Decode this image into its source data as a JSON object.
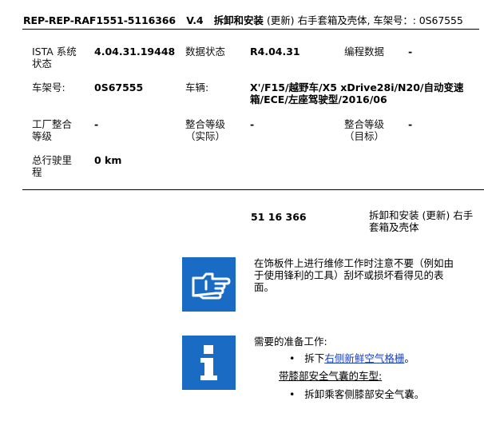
{
  "header": {
    "doc_code": "REP-REP-RAF1551-5116366",
    "version": "V.4",
    "title_cn": "拆卸和安装",
    "update_tag": "(更新)",
    "title_rest": "右手套箱及壳体, 车架号：: 0S67555"
  },
  "info": {
    "ista_label": "ISTA 系统\n状态",
    "ista_value": "4.04.31.19448",
    "data_status_label": "数据状态",
    "data_status_value": "R4.04.31",
    "program_data_label": "编程数据",
    "program_data_value": "-",
    "vin_label": "车架号:",
    "vin_value": "0S67555",
    "vehicle_label": "车辆:",
    "vehicle_value": "X'/F15/越野车/X5 xDrive28i/N20/自动变速\n箱/ECE/左座驾驶型/2016/06",
    "factory_level_label": "工厂整合\n等级",
    "factory_level_value": "-",
    "actual_level_label": "整合等级\n（实际）",
    "actual_level_value": "-",
    "target_level_label": "整合等级\n（目标）",
    "target_level_value": "-",
    "mileage_label": "总行驶里\n程",
    "mileage_value": "0 km"
  },
  "procedure": {
    "code": "51 16 366",
    "title": "拆卸和安装 (更新) 右手\n套箱及壳体"
  },
  "note_block": {
    "icon": "pointing-hand-icon",
    "text": "在饰板件上进行维修工作时注意不要（例如由\n于使用锋利的工具）刮坏或损坏看得见的表\n面。"
  },
  "prep_block": {
    "icon": "info-icon",
    "heading": "需要的准备工作:",
    "step1_prefix": "拆下",
    "step1_link": "右侧新鲜空气格栅",
    "step1_suffix": "。",
    "condition": "带膝部安全气囊的车型:",
    "step2": "拆卸乘客侧膝部安全气囊。"
  },
  "colors": {
    "icon_bg": "#1a6bc4",
    "link": "#1a3fc4"
  }
}
